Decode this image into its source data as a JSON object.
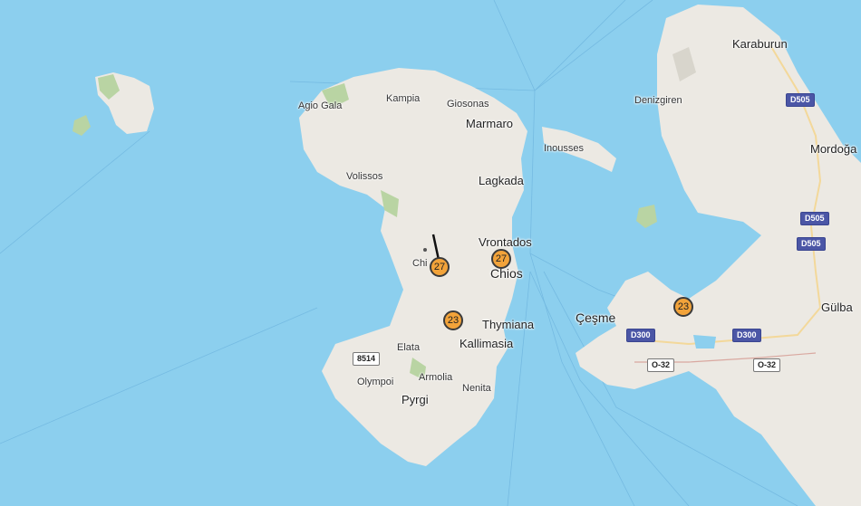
{
  "colors": {
    "sea": "#8ccfee",
    "land": "#ece9e3",
    "forest": "#b9d4a3",
    "cluster": "#f2a33a",
    "shield_blue": "#4b56a6"
  },
  "places": {
    "agio_gala": "Agio Gala",
    "kampia": "Kampia",
    "giosonas": "Giosonas",
    "marmaro": "Marmaro",
    "volissos": "Volissos",
    "lagkada": "Lagkada",
    "vrontados": "Vrontados",
    "chios": "Chios",
    "chios_partial": "Chi",
    "thymiana": "Thymiana",
    "kallimasia": "Kallimasia",
    "elata": "Elata",
    "olympoi": "Olympoi",
    "armolia": "Armolia",
    "pyrgi": "Pyrgi",
    "nenita": "Nenita",
    "inousses": "Inousses",
    "karaburun": "Karaburun",
    "denizgiren": "Denizgiren",
    "mordogan": "Mordoğa",
    "gulbahce": "Gülba",
    "cesme": "Çeşme"
  },
  "roads": {
    "b8514": "8514",
    "d505_a": "D505",
    "d505_b": "D505",
    "d505_c": "D505",
    "d300_a": "D300",
    "d300_b": "D300",
    "o32_a": "O-32",
    "o32_b": "O-32"
  },
  "clusters": {
    "c1": "27",
    "c2": "27",
    "c3": "23",
    "c4": "23"
  }
}
